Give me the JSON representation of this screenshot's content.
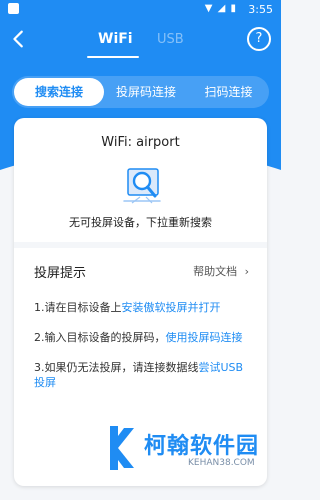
{
  "status": {
    "time": "3:55"
  },
  "header": {
    "tab_wifi": "WiFi",
    "tab_usb": "USB"
  },
  "segment": {
    "search": "搜索连接",
    "code": "投屏码连接",
    "scan": "扫码连接"
  },
  "card": {
    "wifi_name": "WiFi: airport",
    "message": "无可投屏设备，下拉重新搜索",
    "tips_title": "投屏提示",
    "help_doc": "帮助文档",
    "tip1_prefix": "1.请在目标设备上",
    "tip1_link": "安装傲软投屏并打开",
    "tip2_prefix": "2.输入目标设备的投屏码，",
    "tip2_link": "使用投屏码连接",
    "tip3_prefix": "3.如果仍无法投屏，请连接数据线",
    "tip3_link": "尝试USB投屏"
  },
  "watermark": {
    "brand": "柯翰软件园",
    "domain": "KEHAN38.COM"
  },
  "colors": {
    "accent": "#1f8cf3",
    "background": "#f4f6f9"
  },
  "icons": {
    "back": "chevron-left-icon",
    "help": "help-circle-icon",
    "search_illustration": "search-icon"
  }
}
